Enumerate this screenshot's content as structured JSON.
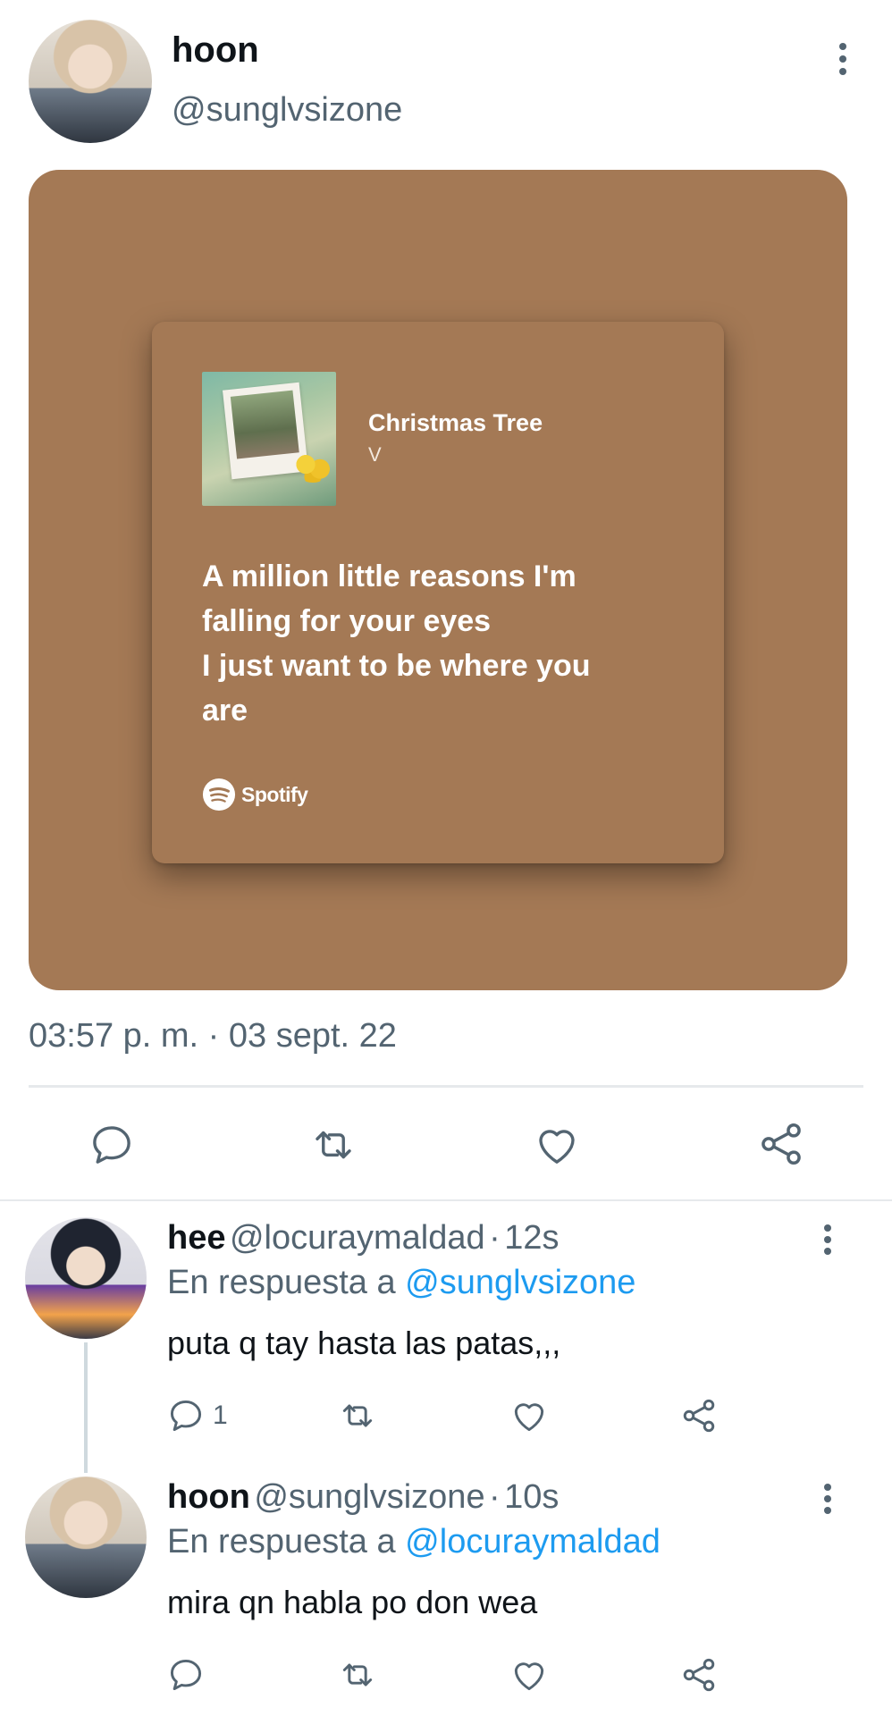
{
  "tweet": {
    "author_name": "hoon",
    "author_handle": "@sunglvsizone",
    "timestamp": "03:57 p. m. · 03 sept. 22",
    "media": {
      "background": "#a47955",
      "song_title": "Christmas Tree",
      "artist": "V",
      "album_cover_text": "Christmas Tree",
      "lyrics": [
        "A million little reasons I'm",
        "falling for your eyes",
        "I just want to be where you",
        "are"
      ],
      "brand": "Spotify"
    },
    "actions": [
      "comment-icon",
      "retweet-icon",
      "heart-icon",
      "share-icon"
    ]
  },
  "replies": [
    {
      "name": "hee",
      "handle": "@locuraymaldad",
      "separator": "·",
      "time": "12s",
      "reply_prefix": "En respuesta a",
      "reply_to": "@sunglvsizone",
      "text": "puta q tay hasta las patas,,,",
      "comment_count": "1"
    },
    {
      "name": "hoon",
      "handle": "@sunglvsizone",
      "separator": "·",
      "time": "10s",
      "reply_prefix": "En respuesta a",
      "reply_to": "@locuraymaldad",
      "text": "mira qn habla po don wea",
      "comment_count": ""
    }
  ],
  "colors": {
    "text_primary": "#0f1419",
    "text_secondary": "#536471",
    "link": "#1d9bf0",
    "divider": "#e6e9ec"
  }
}
